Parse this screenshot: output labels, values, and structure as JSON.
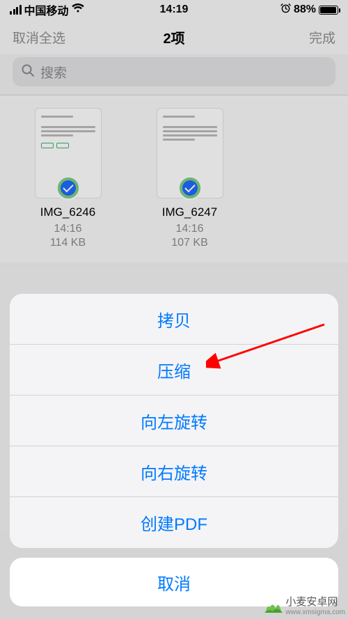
{
  "status": {
    "carrier": "中国移动",
    "time": "14:19",
    "battery_pct": "88%",
    "alarm_icon": "alarm-icon",
    "wifi_icon": "wifi-icon"
  },
  "nav": {
    "left": "取消全选",
    "title": "2项",
    "right": "完成"
  },
  "search": {
    "placeholder": "搜索"
  },
  "files": [
    {
      "name": "IMG_6246",
      "time": "14:16",
      "size": "114 KB",
      "selected": true
    },
    {
      "name": "IMG_6247",
      "time": "14:16",
      "size": "107 KB",
      "selected": true
    }
  ],
  "sheet": {
    "actions": [
      "拷贝",
      "压缩",
      "向左旋转",
      "向右旋转",
      "创建PDF"
    ],
    "cancel": "取消"
  },
  "watermark": {
    "brand": "小麦安卓网",
    "url": "www.xmsigma.com"
  },
  "colors": {
    "accent": "#007aff",
    "checkmark_bg": "#1f69ff"
  }
}
